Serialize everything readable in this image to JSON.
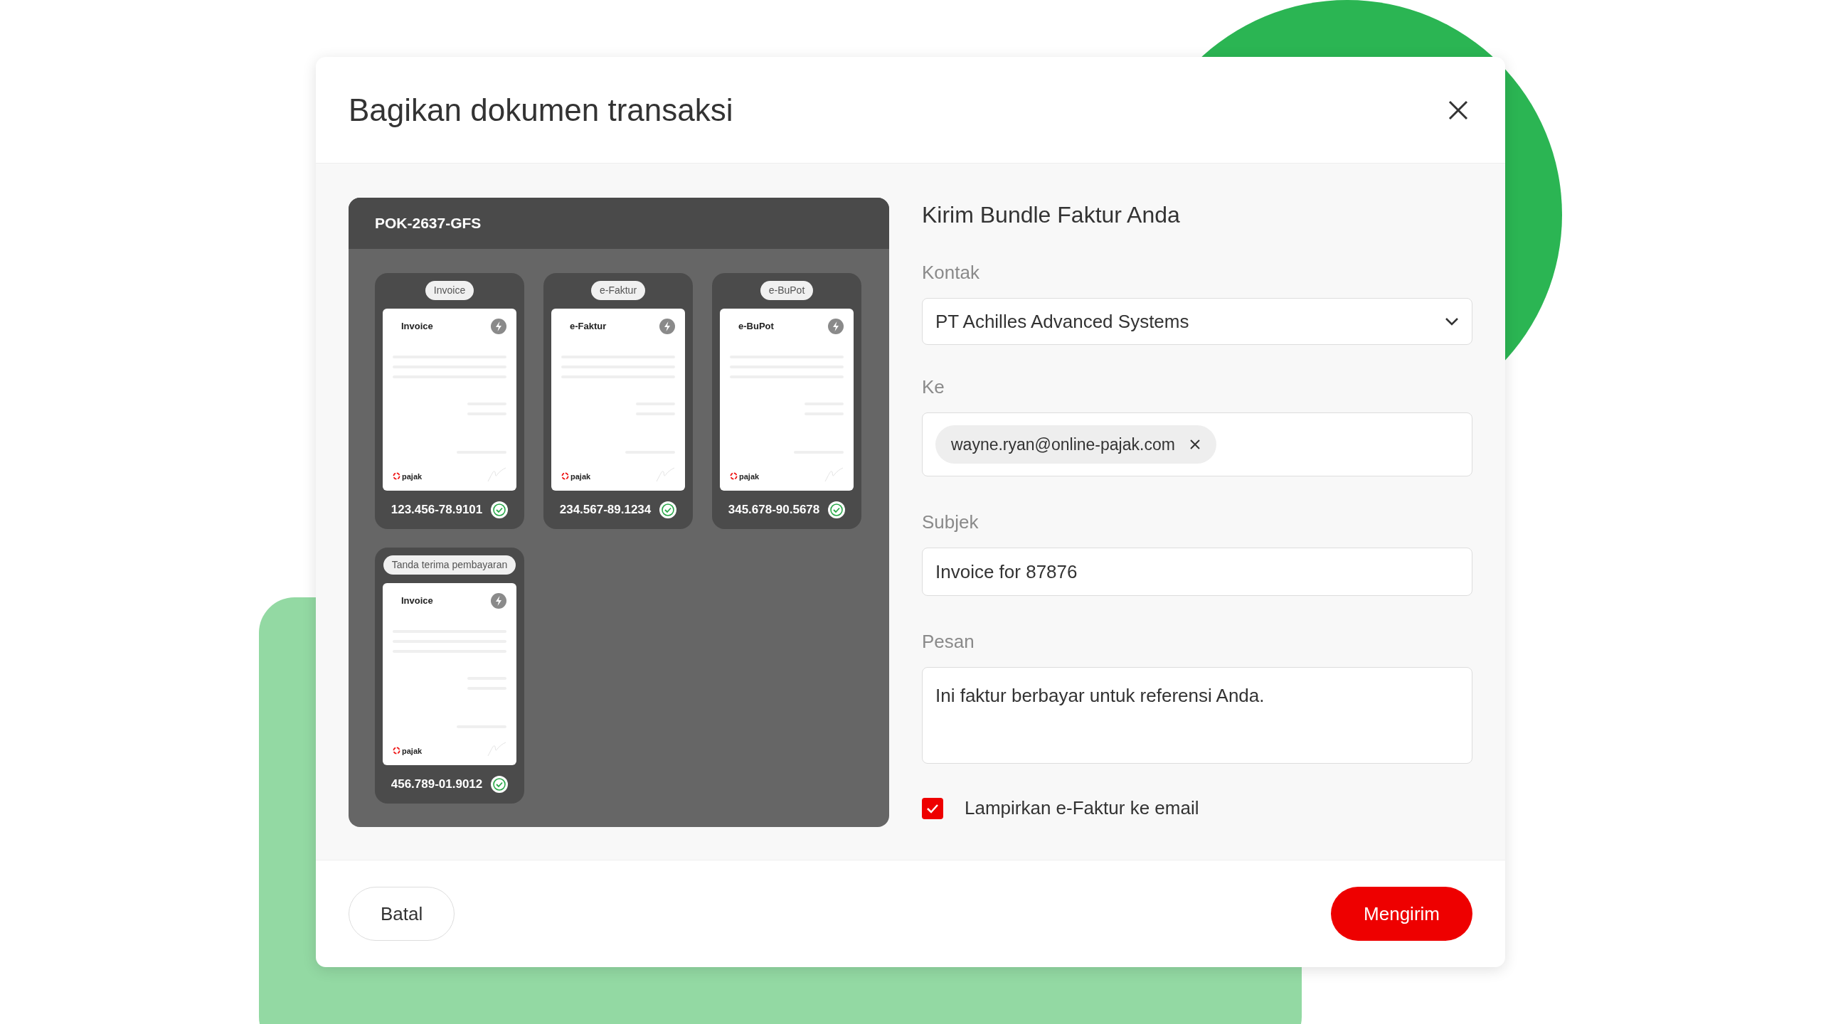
{
  "dialog": {
    "title": "Bagikan dokumen transaksi"
  },
  "bundle": {
    "code": "POK-2637-GFS",
    "documents": [
      {
        "tag": "Invoice",
        "doc_title": "Invoice",
        "brand": "pajak",
        "number": "123.456-78.9101"
      },
      {
        "tag": "e-Faktur",
        "doc_title": "e-Faktur",
        "brand": "pajak",
        "number": "234.567-89.1234"
      },
      {
        "tag": "e-BuPot",
        "doc_title": "e-BuPot",
        "brand": "pajak",
        "number": "345.678-90.5678"
      },
      {
        "tag": "Tanda terima pembayaran",
        "doc_title": "Invoice",
        "brand": "pajak",
        "number": "456.789-01.9012"
      }
    ]
  },
  "form": {
    "heading": "Kirim Bundle Faktur Anda",
    "contact": {
      "label": "Kontak",
      "value": "PT Achilles Advanced Systems"
    },
    "to": {
      "label": "Ke",
      "chips": [
        "wayne.ryan@online-pajak.com"
      ]
    },
    "subject": {
      "label": "Subjek",
      "value": "Invoice for 87876"
    },
    "message": {
      "label": "Pesan",
      "value": "Ini faktur berbayar untuk referensi Anda."
    },
    "attach": {
      "label": "Lampirkan e-Faktur ke email",
      "checked": true
    }
  },
  "footer": {
    "cancel": "Batal",
    "submit": "Mengirim"
  }
}
